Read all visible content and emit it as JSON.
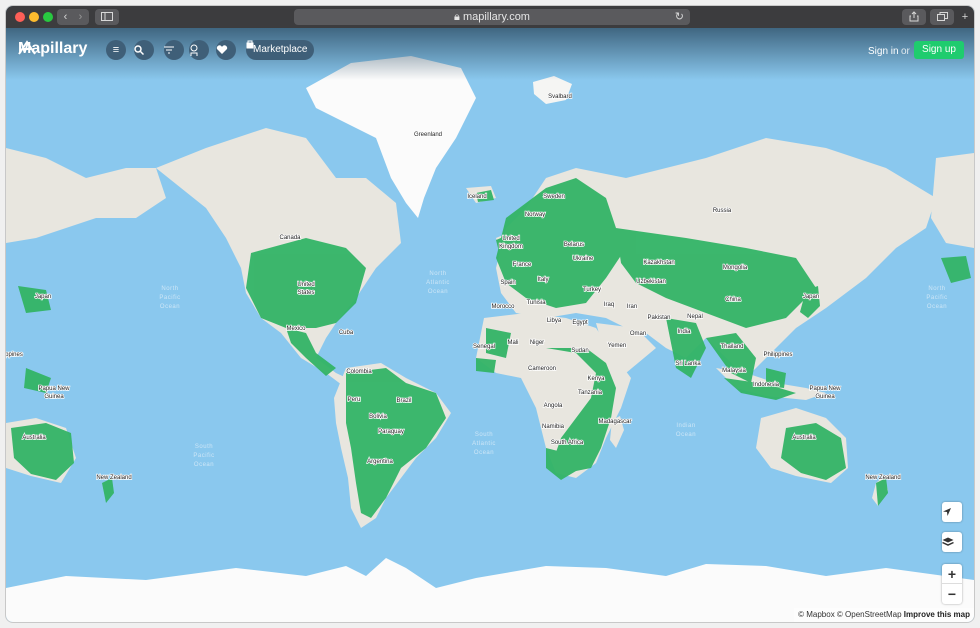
{
  "browser": {
    "url": "mapillary.com",
    "lock_icon": "lock-icon",
    "reload_icon": "reload-icon"
  },
  "header": {
    "brand": "Mapillary",
    "marketplace": "Marketplace",
    "sign_in": "Sign in",
    "or": "or",
    "sign_up": "Sign up",
    "accent_color": "#1fcc6e"
  },
  "map": {
    "coverage_color": "#33b466",
    "land_color": "#e8e6df",
    "ice_color": "#fbfbfb",
    "water_color": "#8ac8ee",
    "labels": {
      "svalbard": "Svalbard",
      "greenland": "Greenland",
      "iceland": "Iceland",
      "sweden": "Sweden",
      "norway": "Norway",
      "russia": "Russia",
      "canada": "Canada",
      "united_kingdom": "United Kingdom",
      "belarus": "Belarus",
      "ukraine": "Ukraine",
      "kazakhstan": "Kazakhstan",
      "mongolia": "Mongolia",
      "france": "France",
      "spain": "Spain",
      "italy": "Italy",
      "uzbekistan": "Uzbekistan",
      "united_states": "United States",
      "turkey": "Turkey",
      "china": "China",
      "japan": "Japan",
      "morocco": "Morocco",
      "tunisia": "Tunisia",
      "iraq": "Iraq",
      "iran": "Iran",
      "libya": "Libya",
      "egypt": "Egypt",
      "pakistan": "Pakistan",
      "nepal": "Nepal",
      "mexico": "Mexico",
      "cuba": "Cuba",
      "oman": "Oman",
      "india": "India",
      "mali": "Mali",
      "niger": "Niger",
      "sudan": "Sudan",
      "senegal": "Senegal",
      "yemen": "Yemen",
      "thailand": "Thailand",
      "philippines": "Philippines",
      "cameroon": "Cameroon",
      "sri_lanka": "Sri Lanka",
      "colombia": "Colombia",
      "kenya": "Kenya",
      "malaysia": "Malaysia",
      "indonesia": "Indonesia",
      "tanzania": "Tanzania",
      "papua_new_guinea": "Papua New Guinea",
      "peru": "Peru",
      "brazil": "Brazil",
      "angola": "Angola",
      "bolivia": "Bolivia",
      "madagascar": "Madagascar",
      "namibia": "Namibia",
      "paraguay": "Paraguay",
      "australia": "Australia",
      "south_africa": "South Africa",
      "argentina": "Argentina",
      "new_zealand": "New Zealand",
      "north_pacific_ocean": "North Pacific Ocean",
      "north_atlantic_ocean": "North Atlantic Ocean",
      "south_atlantic_ocean": "South Atlantic Ocean",
      "south_pacific_ocean": "South Pacific Ocean",
      "indian_ocean": "Indian Ocean"
    }
  },
  "controls": {
    "locate_icon": "locate-arrow-icon",
    "layers_icon": "layers-icon",
    "zoom_in": "+",
    "zoom_out": "−"
  },
  "attribution": {
    "mapbox": "© Mapbox",
    "osm": "© OpenStreetMap",
    "improve": "Improve this map"
  }
}
